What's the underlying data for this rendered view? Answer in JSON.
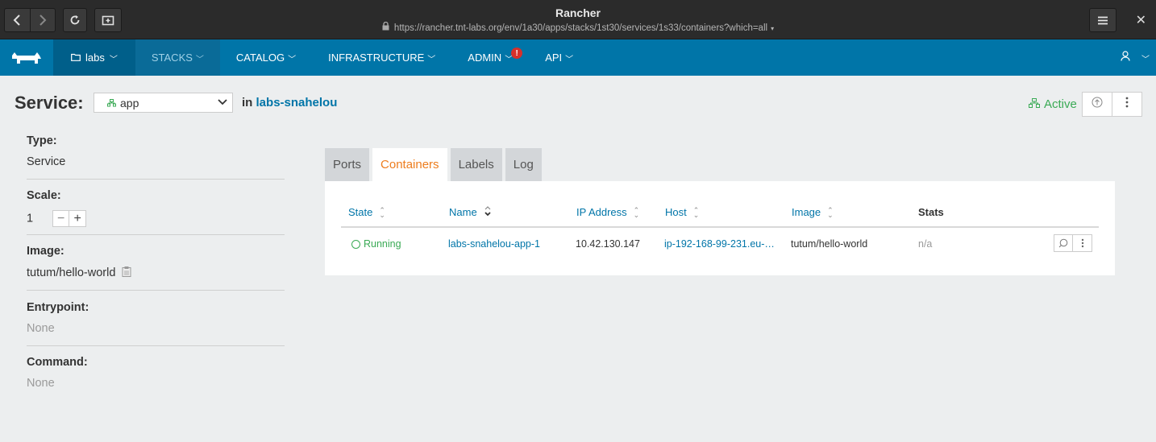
{
  "browser": {
    "title": "Rancher",
    "url": "https://rancher.tnt-labs.org/env/1a30/apps/stacks/1st30/services/1s33/containers?which=all"
  },
  "nav": {
    "environment": "labs",
    "menus": [
      {
        "label": "STACKS"
      },
      {
        "label": "CATALOG"
      },
      {
        "label": "INFRASTRUCTURE"
      },
      {
        "label": "ADMIN"
      },
      {
        "label": "API"
      }
    ],
    "admin_alert": "!"
  },
  "service": {
    "heading": "Service:",
    "selected": "app",
    "in_label": "in",
    "stack": "labs-snahelou",
    "state": "Active"
  },
  "info": {
    "type_label": "Type:",
    "type_value": "Service",
    "scale_label": "Scale:",
    "scale_value": "1",
    "image_label": "Image:",
    "image_value": "tutum/hello-world",
    "entrypoint_label": "Entrypoint:",
    "entrypoint_value": "None",
    "command_label": "Command:",
    "command_value": "None"
  },
  "tabs": [
    {
      "label": "Ports"
    },
    {
      "label": "Containers"
    },
    {
      "label": "Labels"
    },
    {
      "label": "Log"
    }
  ],
  "table": {
    "headers": {
      "state": "State",
      "name": "Name",
      "ip": "IP Address",
      "host": "Host",
      "image": "Image",
      "stats": "Stats"
    },
    "rows": [
      {
        "state": "Running",
        "name": "labs-snahelou-app-1",
        "ip": "10.42.130.147",
        "host": "ip-192-168-99-231.eu-…",
        "image": "tutum/hello-world",
        "stats": "n/a"
      }
    ]
  },
  "colors": {
    "brand": "#0075a8",
    "active": "#3aaa55",
    "tab_selected": "#ed7d1e",
    "alert": "#d6302b"
  }
}
